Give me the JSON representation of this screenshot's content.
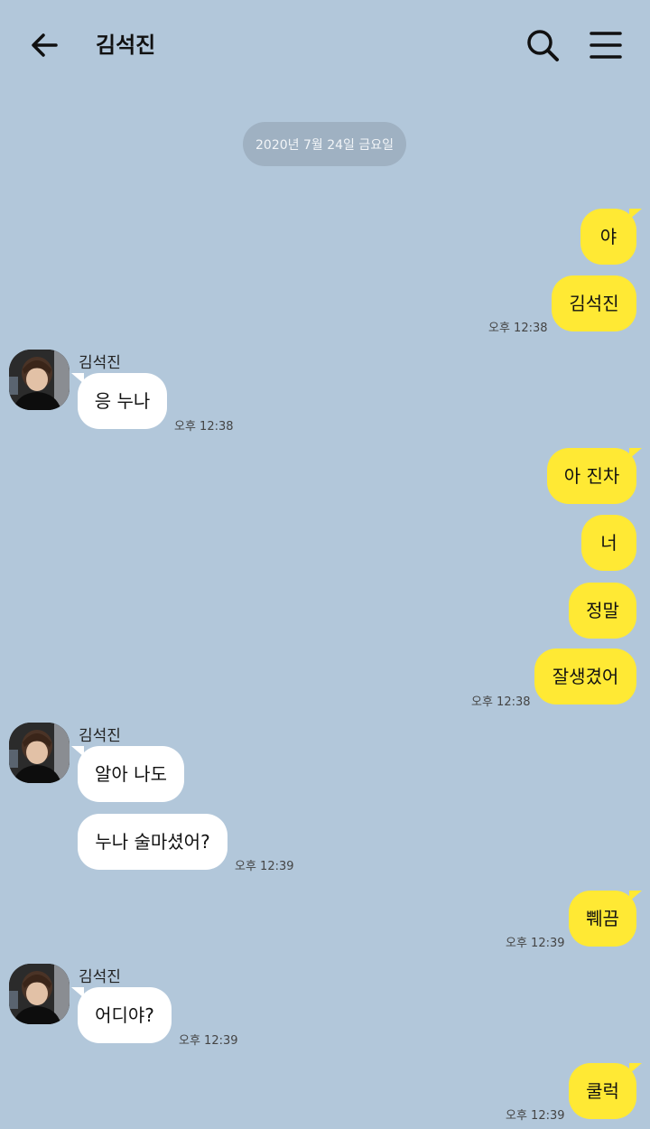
{
  "header": {
    "title": "김석진",
    "back_icon": "arrow-left-icon",
    "search_icon": "search-icon",
    "menu_icon": "menu-icon"
  },
  "date_divider": "2020년 7월 24일 금요일",
  "messages": {
    "m1": "야",
    "m2": "김석진",
    "t1": "오후 12:38",
    "s1": "김석진",
    "r1": "응 누나",
    "t2": "오후 12:38",
    "m3": "아 진차",
    "m4": "너",
    "m5": "정말",
    "m6": "잘생겼어",
    "t3": "오후 12:38",
    "s2": "김석진",
    "r2": "알아 나도",
    "r3": "누나 술마셨어?",
    "t4": "오후 12:39",
    "m7": "쀄끔",
    "t5": "오후 12:39",
    "s3": "김석진",
    "r4": "어디야?",
    "t6": "오후 12:39",
    "m8": "쿨럭",
    "t7": "오후 12:39"
  },
  "colors": {
    "background": "#b2c7da",
    "my_bubble": "#ffe934",
    "their_bubble": "#ffffff",
    "date_pill": "#9fb1c2"
  }
}
